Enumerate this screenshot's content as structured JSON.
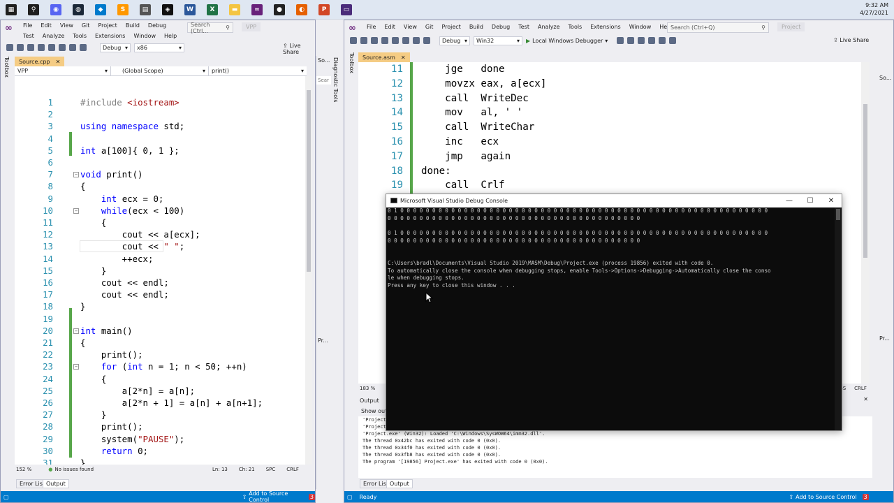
{
  "taskbar": {
    "icons": [
      {
        "name": "windows-start-icon",
        "glyph": "▦",
        "color": "#1f1f1f"
      },
      {
        "name": "search-icon",
        "glyph": "⚲",
        "color": "#1f1f1f"
      },
      {
        "name": "discord-icon",
        "glyph": "◉",
        "color": "#5865f2"
      },
      {
        "name": "steam-icon",
        "glyph": "◍",
        "color": "#1b2838"
      },
      {
        "name": "vscode-icon",
        "glyph": "◆",
        "color": "#007acc"
      },
      {
        "name": "sublime-icon",
        "glyph": "S",
        "color": "#ff9800"
      },
      {
        "name": "notepad-icon",
        "glyph": "▤",
        "color": "#555555"
      },
      {
        "name": "app-diamond-icon",
        "glyph": "◈",
        "color": "#111111"
      },
      {
        "name": "word-icon",
        "glyph": "W",
        "color": "#2b579a"
      },
      {
        "name": "excel-icon",
        "glyph": "X",
        "color": "#217346"
      },
      {
        "name": "folder-icon",
        "glyph": "▬",
        "color": "#f4c542"
      },
      {
        "name": "visual-studio-icon",
        "glyph": "∞",
        "color": "#68217a"
      },
      {
        "name": "obs-icon",
        "glyph": "●",
        "color": "#222222"
      },
      {
        "name": "firefox-icon",
        "glyph": "◐",
        "color": "#e66000"
      },
      {
        "name": "powerpoint-icon",
        "glyph": "P",
        "color": "#d24726"
      },
      {
        "name": "terminal-icon",
        "glyph": "▭",
        "color": "#4b2c7a"
      }
    ],
    "time": "9:32 AM",
    "date": "4/27/2021"
  },
  "left_window": {
    "menu": [
      "File",
      "Edit",
      "View",
      "Git",
      "Project",
      "Build",
      "Debug",
      "Test",
      "Analyze",
      "Tools",
      "Extensions",
      "Window",
      "Help"
    ],
    "search_placeholder": "Search (Ctrl...",
    "solution": "VPP",
    "config": "Debug",
    "platform": "x86",
    "live_share": "Live Share",
    "toolbox": "Toolbox",
    "doc_tab": "Source.cpp",
    "nav_project": "VPP",
    "nav_scope": "(Global Scope)",
    "nav_member": "print()",
    "zoom": "152 %",
    "issues": "No issues found",
    "ln": "Ln: 13",
    "ch": "Ch: 21",
    "spc": "SPC",
    "crlf": "CRLF",
    "tab_error_list": "Error List",
    "tab_output": "Output",
    "status_source_control": "Add to Source Control",
    "side_tabs": [
      "So...",
      "Diagnostic Tools",
      "Pr..."
    ],
    "side_search": "Sear",
    "code": [
      {
        "n": "1",
        "t": "#include <iostream>"
      },
      {
        "n": "2",
        "t": ""
      },
      {
        "n": "3",
        "t": "using namespace std;"
      },
      {
        "n": "4",
        "t": ""
      },
      {
        "n": "5",
        "t": "int a[100]{ 0, 1 };"
      },
      {
        "n": "6",
        "t": ""
      },
      {
        "n": "7",
        "t": "void print()"
      },
      {
        "n": "8",
        "t": "{"
      },
      {
        "n": "9",
        "t": "    int ecx = 0;"
      },
      {
        "n": "10",
        "t": "    while(ecx < 100)"
      },
      {
        "n": "11",
        "t": "    {"
      },
      {
        "n": "12",
        "t": "        cout << a[ecx];"
      },
      {
        "n": "13",
        "t": "        cout << \" \";"
      },
      {
        "n": "14",
        "t": "        ++ecx;"
      },
      {
        "n": "15",
        "t": "    }"
      },
      {
        "n": "16",
        "t": "    cout << endl;"
      },
      {
        "n": "17",
        "t": "    cout << endl;"
      },
      {
        "n": "18",
        "t": "}"
      },
      {
        "n": "19",
        "t": ""
      },
      {
        "n": "20",
        "t": "int main()"
      },
      {
        "n": "21",
        "t": "{"
      },
      {
        "n": "22",
        "t": "    print();"
      },
      {
        "n": "23",
        "t": "    for (int n = 1; n < 50; ++n)"
      },
      {
        "n": "24",
        "t": "    {"
      },
      {
        "n": "25",
        "t": "        a[2*n] = a[n];"
      },
      {
        "n": "26",
        "t": "        a[2*n + 1] = a[n] + a[n+1];"
      },
      {
        "n": "27",
        "t": "    }"
      },
      {
        "n": "28",
        "t": "    print();"
      },
      {
        "n": "29",
        "t": "    system(\"PAUSE\");"
      },
      {
        "n": "30",
        "t": "    return 0;"
      },
      {
        "n": "31",
        "t": "}"
      }
    ]
  },
  "right_window": {
    "menu": [
      "File",
      "Edit",
      "View",
      "Git",
      "Project",
      "Build",
      "Debug",
      "Test",
      "Analyze",
      "Tools",
      "Extensions",
      "Window",
      "Help"
    ],
    "search_placeholder": "Search (Ctrl+Q)",
    "solution": "Project",
    "config": "Debug",
    "platform": "Win32",
    "debugger": "Local Windows Debugger",
    "live_share": "Live Share",
    "toolbox": "Toolbox",
    "doc_tab": "Source.asm",
    "zoom": "183 %",
    "abs": "ABS",
    "crlf": "CRLF",
    "output_title": "Output",
    "output_show": "Show outp",
    "output_lines": [
      "'Project",
      "'Project",
      "'Project.exe' (Win32): Loaded 'C:\\Windows\\SysWOW64\\imm32.dll'.",
      "The thread 0x42bc has exited with code 0 (0x0).",
      "The thread 0x34f0 has exited with code 0 (0x0).",
      "The thread 0x3fb8 has exited with code 0 (0x0).",
      "The program '[19856] Project.exe' has exited with code 0 (0x0)."
    ],
    "tab_error_list": "Error List",
    "tab_output": "Output",
    "status_ready": "Ready",
    "status_source_control": "Add to Source Control",
    "side_tabs": [
      "So...",
      "Pr..."
    ],
    "code": [
      {
        "n": "11",
        "t": "    jge   done"
      },
      {
        "n": "12",
        "t": "    movzx eax, a[ecx]"
      },
      {
        "n": "13",
        "t": "    call  WriteDec"
      },
      {
        "n": "14",
        "t": "    mov   al, ' '"
      },
      {
        "n": "15",
        "t": "    call  WriteChar"
      },
      {
        "n": "16",
        "t": "    inc   ecx"
      },
      {
        "n": "17",
        "t": "    jmp   again"
      },
      {
        "n": "18",
        "t": "done:"
      },
      {
        "n": "19",
        "t": "    call  Crlf"
      }
    ]
  },
  "console": {
    "title": "Microsoft Visual Studio Debug Console",
    "minimize": "—",
    "maximize": "☐",
    "close": "✕",
    "lines": [
      "0 1 0 0 0 0 0 0 0 0 0 0 0 0 0 0 0 0 0 0 0 0 0 0 0 0 0 0 0 0 0 0 0 0 0 0 0 0 0 0 0 0 0 0 0 0 0 0 0 0 0 0 0 0 0 0 0 0 0 0",
      "0 0 0 0 0 0 0 0 0 0 0 0 0 0 0 0 0 0 0 0 0 0 0 0 0 0 0 0 0 0 0 0 0 0 0 0 0 0 0 0",
      "",
      "0 1 0 0 0 0 0 0 0 0 0 0 0 0 0 0 0 0 0 0 0 0 0 0 0 0 0 0 0 0 0 0 0 0 0 0 0 0 0 0 0 0 0 0 0 0 0 0 0 0 0 0 0 0 0 0 0 0 0 0",
      "0 0 0 0 0 0 0 0 0 0 0 0 0 0 0 0 0 0 0 0 0 0 0 0 0 0 0 0 0 0 0 0 0 0 0 0 0 0 0 0",
      "",
      "",
      "C:\\Users\\bradl\\Documents\\Visual Studio 2019\\MASM\\Debug\\Project.exe (process 19856) exited with code 0.",
      "To automatically close the console when debugging stops, enable Tools->Options->Debugging->Automatically close the conso",
      "le when debugging stops.",
      "Press any key to close this window . . ."
    ]
  }
}
